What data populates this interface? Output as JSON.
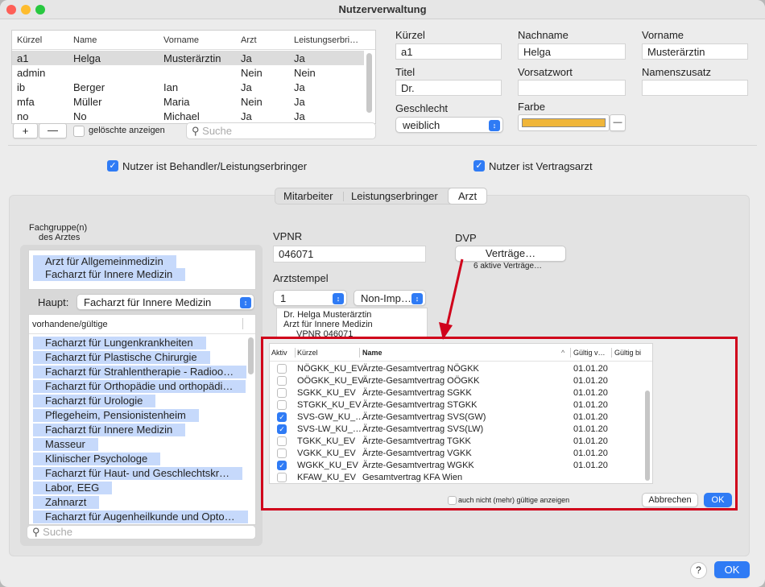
{
  "window": {
    "title": "Nutzerverwaltung",
    "traffic_lights": {
      "close": "#fe5f57",
      "minimize": "#febc2e",
      "zoom": "#28c840"
    }
  },
  "user_table": {
    "headers": [
      "Kürzel",
      "Name",
      "Vorname",
      "Arzt",
      "Leistungserbri…"
    ],
    "rows": [
      [
        "a1",
        "Helga",
        "Musterärztin",
        "Ja",
        "Ja"
      ],
      [
        "admin",
        "",
        "",
        "Nein",
        "Nein"
      ],
      [
        "ib",
        "Berger",
        "Ian",
        "Ja",
        "Ja"
      ],
      [
        "mfa",
        "Müller",
        "Maria",
        "Nein",
        "Ja"
      ],
      [
        "no",
        "No",
        "Michael",
        "Ja",
        "Ja"
      ]
    ],
    "add_label": "+",
    "remove_label": "—",
    "show_deleted_label": "gelöschte anzeigen",
    "search_placeholder": "Suche"
  },
  "user_form": {
    "kuerzel_label": "Kürzel",
    "kuerzel_value": "a1",
    "nachname_label": "Nachname",
    "nachname_value": "Helga",
    "vorname_label": "Vorname",
    "vorname_value": "Musterärztin",
    "titel_label": "Titel",
    "titel_value": "Dr.",
    "vorsatzwort_label": "Vorsatzwort",
    "vorsatzwort_value": "",
    "namenszusatz_label": "Namenszusatz",
    "namenszusatz_value": "",
    "geschlecht_label": "Geschlecht",
    "geschlecht_value": "weiblich",
    "farbe_label": "Farbe",
    "farbe_color": "#f0b63a",
    "farbe_remove": "—"
  },
  "options": {
    "behandler_label": "Nutzer ist Behandler/Leistungserbringer",
    "behandler_checked": true,
    "vertragsarzt_label": "Nutzer ist Vertragsarzt",
    "vertragsarzt_checked": true
  },
  "tabs": {
    "items": [
      "Mitarbeiter",
      "Leistungserbringer",
      "Arzt"
    ],
    "selected": "Arzt"
  },
  "fachgruppe": {
    "label_line1": "Fachgruppe(n)",
    "label_line2": "des Arztes",
    "selected": [
      "Arzt für Allgemeinmedizin",
      "Facharzt für Innere Medizin"
    ],
    "haupt_label": "Haupt:",
    "haupt_value": "Facharzt für Innere Medizin",
    "list_header": "vorhandene/gültige",
    "items": [
      "Facharzt für Lungenkrankheiten",
      "Facharzt für Plastische Chirurgie",
      "Facharzt für Strahlentherapie - Radioo…",
      "Facharzt für Orthopädie und orthopädi…",
      "Facharzt für Urologie",
      "Pflegeheim, Pensionistenheim",
      "Facharzt für Innere Medizin",
      "Masseur",
      "Klinischer Psychologe",
      "Facharzt für Haut- und Geschlechtskr…",
      "Labor, EEG",
      "Zahnarzt",
      "Facharzt für Augenheilkunde und Opto…"
    ],
    "search_placeholder": "Suche"
  },
  "vpnr": {
    "label": "VPNR",
    "value": "046071"
  },
  "arztstempel": {
    "label": "Arztstempel",
    "number": "1",
    "type": "Non-Imp…",
    "lines": [
      "Dr. Helga Musterärztin",
      "Arzt für Innere Medizin",
      "VPNR 046071"
    ]
  },
  "dvp": {
    "label": "DVP",
    "button_label": "Verträge…",
    "status": "6 aktive Verträge…"
  },
  "contracts_dialog": {
    "headers": {
      "aktiv": "Aktiv",
      "kuerzel": "Kürzel",
      "name": "Name",
      "gueltig_von": "Gültig v…",
      "gueltig_bis": "Gültig bi"
    },
    "rows": [
      {
        "active": false,
        "kuerzel": "NÖGKK_KU_EV",
        "name": "Ärzte-Gesamtvertrag NÖGKK",
        "from": "01.01.20"
      },
      {
        "active": false,
        "kuerzel": "OÖGKK_KU_EV",
        "name": "Ärzte-Gesamtvertrag OÖGKK",
        "from": "01.01.20"
      },
      {
        "active": false,
        "kuerzel": "SGKK_KU_EV",
        "name": "Ärzte-Gesamtvertrag SGKK",
        "from": "01.01.20"
      },
      {
        "active": false,
        "kuerzel": "STGKK_KU_EV",
        "name": "Ärzte-Gesamtvertrag STGKK",
        "from": "01.01.20"
      },
      {
        "active": true,
        "kuerzel": "SVS-GW_KU_…",
        "name": "Ärzte-Gesamtvertrag SVS(GW)",
        "from": "01.01.20"
      },
      {
        "active": true,
        "kuerzel": "SVS-LW_KU_…",
        "name": "Ärzte-Gesamtvertrag SVS(LW)",
        "from": "01.01.20"
      },
      {
        "active": false,
        "kuerzel": "TGKK_KU_EV",
        "name": "Ärzte-Gesamtvertrag TGKK",
        "from": "01.01.20"
      },
      {
        "active": false,
        "kuerzel": "VGKK_KU_EV",
        "name": "Ärzte-Gesamtvertrag VGKK",
        "from": "01.01.20"
      },
      {
        "active": true,
        "kuerzel": "WGKK_KU_EV",
        "name": "Ärzte-Gesamtvertrag WGKK",
        "from": "01.01.20"
      },
      {
        "active": false,
        "kuerzel": "KFAW_KU_EV",
        "name": "Gesamtvertrag KFA Wien",
        "from": ""
      }
    ],
    "show_invalid_label": "auch nicht (mehr) gültige anzeigen",
    "cancel_label": "Abbrechen",
    "ok_label": "OK"
  },
  "highlight_color": "#d0021b",
  "footer": {
    "help_label": "?",
    "ok_label": "OK"
  }
}
